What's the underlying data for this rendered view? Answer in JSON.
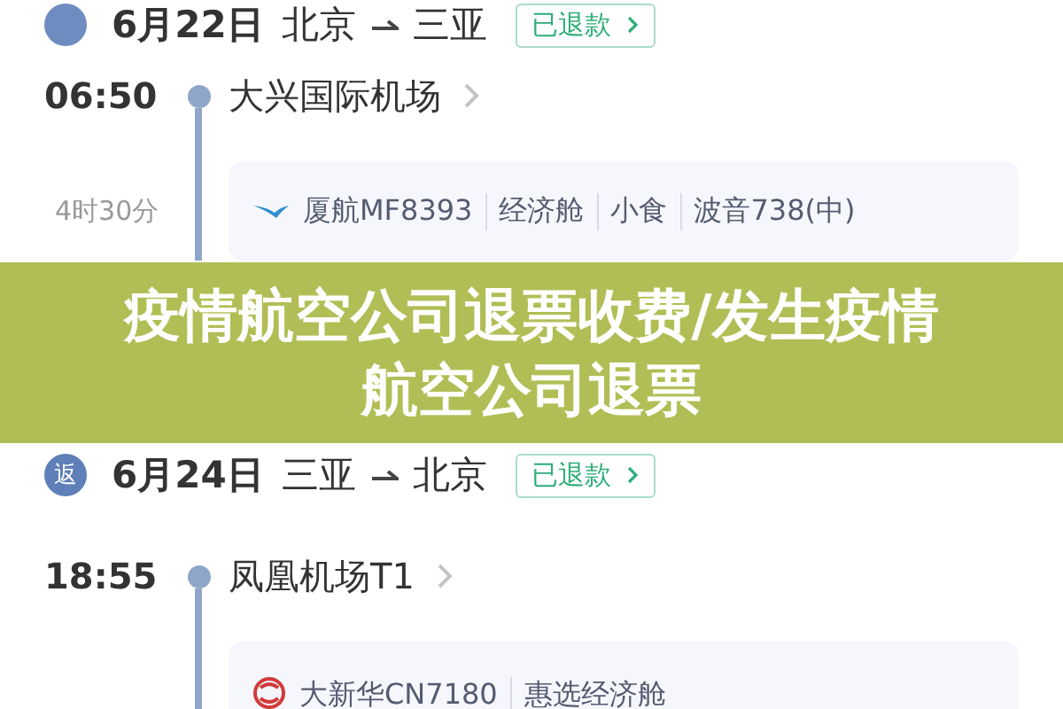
{
  "trips": [
    {
      "date": "6月22日",
      "from": "北京",
      "to": "三亚",
      "status": "已退款",
      "departure": {
        "time": "06:50",
        "station": "大兴国际机场"
      },
      "duration": "4时30分",
      "flight": {
        "kind": "bird",
        "parts": [
          "厦航MF8393",
          "经济舱",
          "小食",
          "波音738(中)"
        ]
      }
    },
    {
      "badge": "返",
      "date": "6月24日",
      "from": "三亚",
      "to": "北京",
      "status": "已退款",
      "departure": {
        "time": "18:55",
        "station": "凤凰机场T1"
      },
      "flight": {
        "kind": "emblem",
        "parts": [
          "大新华CN7180",
          "惠选经济舱"
        ]
      }
    }
  ],
  "banner": {
    "text": "疫情航空公司退票收费/发生疫情航空公司退票"
  }
}
